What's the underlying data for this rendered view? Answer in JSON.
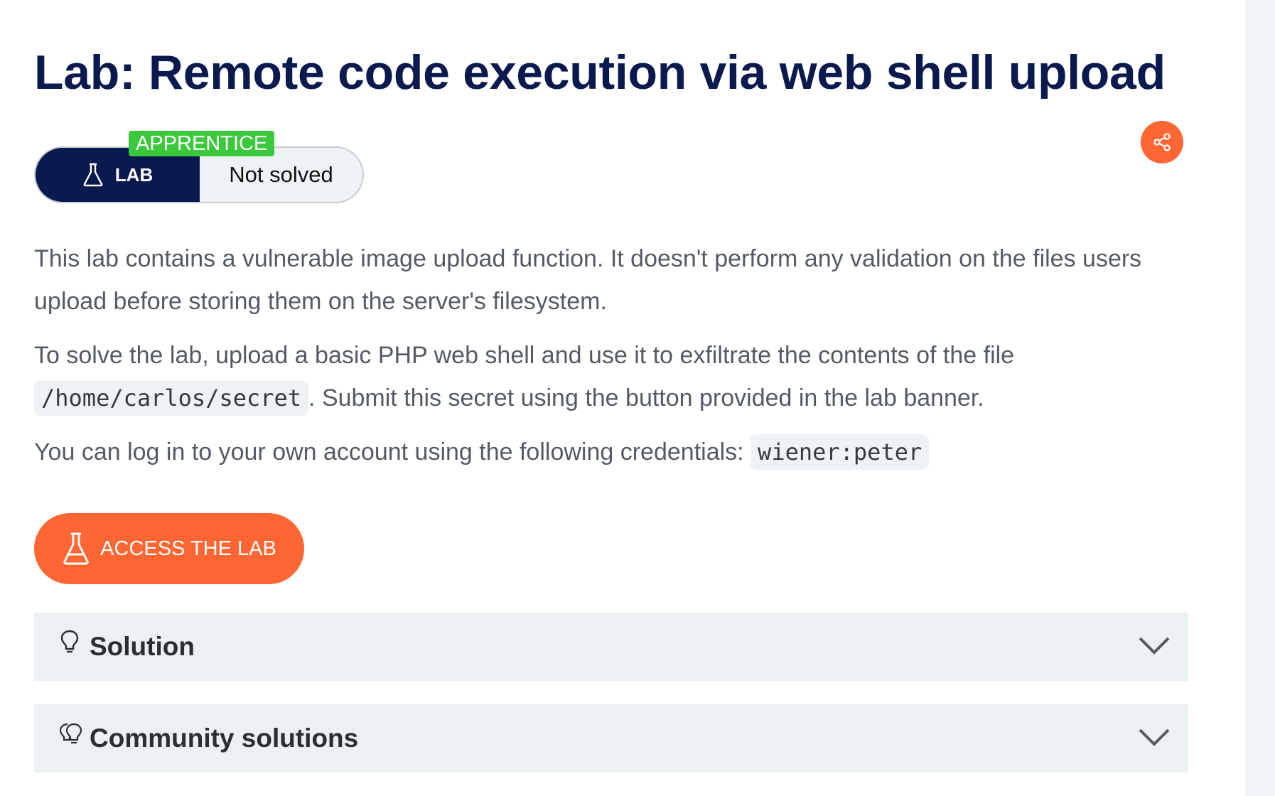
{
  "header": {
    "title": "Lab: Remote code execution via web shell upload"
  },
  "status": {
    "level": "APPRENTICE",
    "type_label": "LAB",
    "state": "Not solved"
  },
  "description": {
    "p1": "This lab contains a vulnerable image upload function. It doesn't perform any validation on the files users upload before storing them on the server's filesystem.",
    "p2_before": "To solve the lab, upload a basic PHP web shell and use it to exfiltrate the contents of the file ",
    "p2_code": "/home/carlos/secret",
    "p2_after": ". Submit this secret using the button provided in the lab banner.",
    "p3_before": "You can log in to your own account using the following credentials: ",
    "p3_code": "wiener:peter"
  },
  "actions": {
    "access_label": "ACCESS THE LAB"
  },
  "accordions": [
    {
      "label": "Solution",
      "icon": "lightbulb-icon"
    },
    {
      "label": "Community solutions",
      "icon": "lightbulbs-icon"
    }
  ],
  "colors": {
    "title": "#0a1a4f",
    "accent": "#ff6633",
    "level_badge": "#3cc83c",
    "accordion_bg": "#ebf0f2"
  }
}
